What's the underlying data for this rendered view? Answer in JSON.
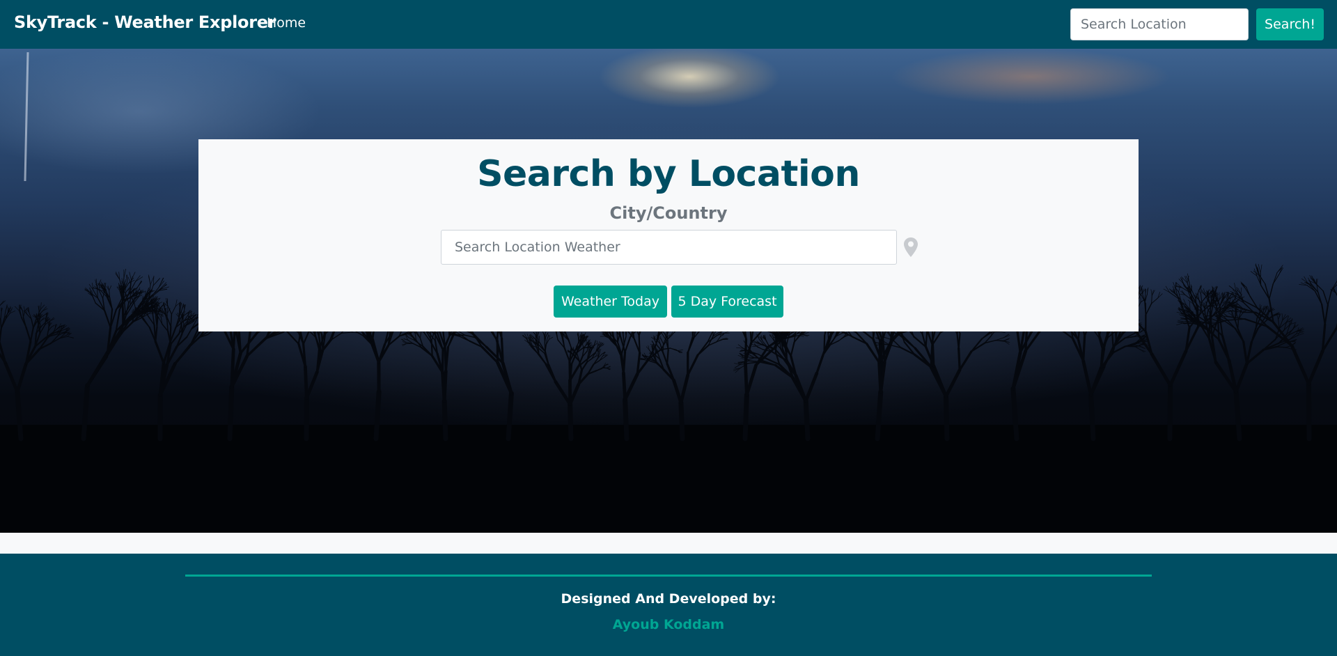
{
  "navbar": {
    "brand": "SkyTrack - Weather Explorer",
    "home_link": "Home",
    "search_placeholder": "Search Location",
    "search_button": "Search!"
  },
  "card": {
    "title": "Search by Location",
    "subtitle": "City/Country",
    "input_placeholder": "Search Location Weather",
    "location_icon": "map-marker-icon",
    "buttons": {
      "today": "Weather Today",
      "forecast": "5 Day Forecast"
    }
  },
  "footer": {
    "credit": "Designed And Developed by:",
    "author": "Ayoub Koddam"
  },
  "colors": {
    "navbar_bg": "#004e63",
    "accent": "#00a693",
    "title": "#004e63",
    "subtitle": "#6c757d",
    "card_bg": "#f8f9fa"
  }
}
